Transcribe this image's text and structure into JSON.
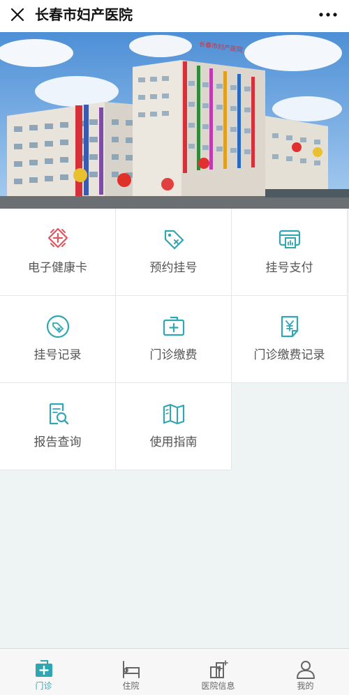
{
  "app": {
    "title": "长春市妇产医院"
  },
  "banner": {
    "sign_text": "长春市妇产医院"
  },
  "menu": [
    {
      "label": "电子健康卡",
      "icon": "health-card-icon"
    },
    {
      "label": "预约挂号",
      "icon": "appointment-tag-icon"
    },
    {
      "label": "挂号支付",
      "icon": "registration-pay-icon"
    },
    {
      "label": "挂号记录",
      "icon": "registration-record-icon"
    },
    {
      "label": "门诊缴费",
      "icon": "outpatient-payment-icon"
    },
    {
      "label": "门诊缴费记录",
      "icon": "payment-record-icon"
    },
    {
      "label": "报告查询",
      "icon": "report-search-icon"
    },
    {
      "label": "使用指南",
      "icon": "guide-map-icon"
    }
  ],
  "tabs": [
    {
      "label": "门诊",
      "icon": "outpatient-icon",
      "active": true
    },
    {
      "label": "住院",
      "icon": "hospital-bed-icon",
      "active": false
    },
    {
      "label": "医院信息",
      "icon": "hospital-info-icon",
      "active": false
    },
    {
      "label": "我的",
      "icon": "user-icon",
      "active": false
    }
  ],
  "colors": {
    "accent": "#2fa6b2",
    "health_card": "#e0555e",
    "background": "#eef3f3"
  }
}
